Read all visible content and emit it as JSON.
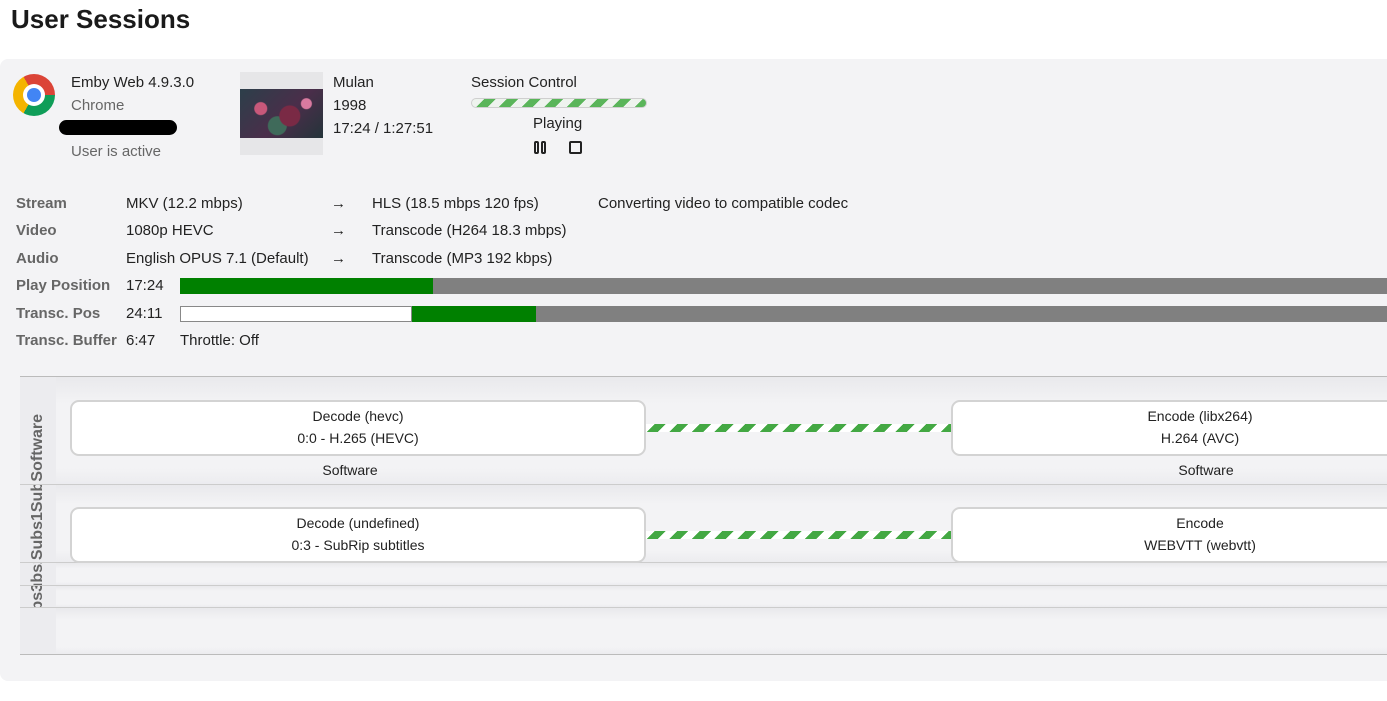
{
  "page_title": "User Sessions",
  "session": {
    "client": "Emby Web 4.9.3.0",
    "browser": "Chrome",
    "user_status": "User is active",
    "media_title": "Mulan",
    "media_year": "1998",
    "media_time": "17:24 / 1:27:51",
    "control_label": "Session Control",
    "play_state": "Playing",
    "icons": [
      "chrome-icon",
      "pause-icon",
      "stop-icon"
    ]
  },
  "info": {
    "stream": {
      "label": "Stream",
      "source": "MKV (12.2 mbps)",
      "arrow": "→",
      "target": "HLS (18.5 mbps 120 fps)",
      "note": "Converting video to compatible codec"
    },
    "video": {
      "label": "Video",
      "source": "1080p HEVC",
      "arrow": "→",
      "target": "Transcode (H264 18.3 mbps)"
    },
    "audio": {
      "label": "Audio",
      "source": "English OPUS 7.1 (Default)",
      "arrow": "→",
      "target": "Transcode (MP3 192 kbps)"
    },
    "play_position": {
      "label": "Play Position",
      "value": "17:24",
      "progress_percent": 21
    },
    "transc_pos": {
      "label": "Transc. Pos",
      "value": "24:11",
      "buffered_start_percent": 19.2,
      "progress_percent": 29.5
    },
    "transc_buffer": {
      "label": "Transc. Buffer",
      "value": "6:47",
      "throttle": "Throttle: Off"
    }
  },
  "pipeline": {
    "rows": [
      {
        "label": "Software",
        "decode_title": "Decode (hevc)",
        "decode_detail": "0:0 - H.265 (HEVC)",
        "encode_title": "Encode (libx264)",
        "encode_detail": "H.264 (AVC)",
        "decode_hw": "Software",
        "encode_hw": "Software"
      },
      {
        "label": "Subs1Subs",
        "decode_title": "Decode (undefined)",
        "decode_detail": "0:3 - SubRip subtitles",
        "encode_title": "Encode",
        "encode_detail": "WEBVTT (webvtt)"
      },
      {
        "label": "Subs2"
      },
      {
        "label": "Subs3"
      }
    ]
  }
}
